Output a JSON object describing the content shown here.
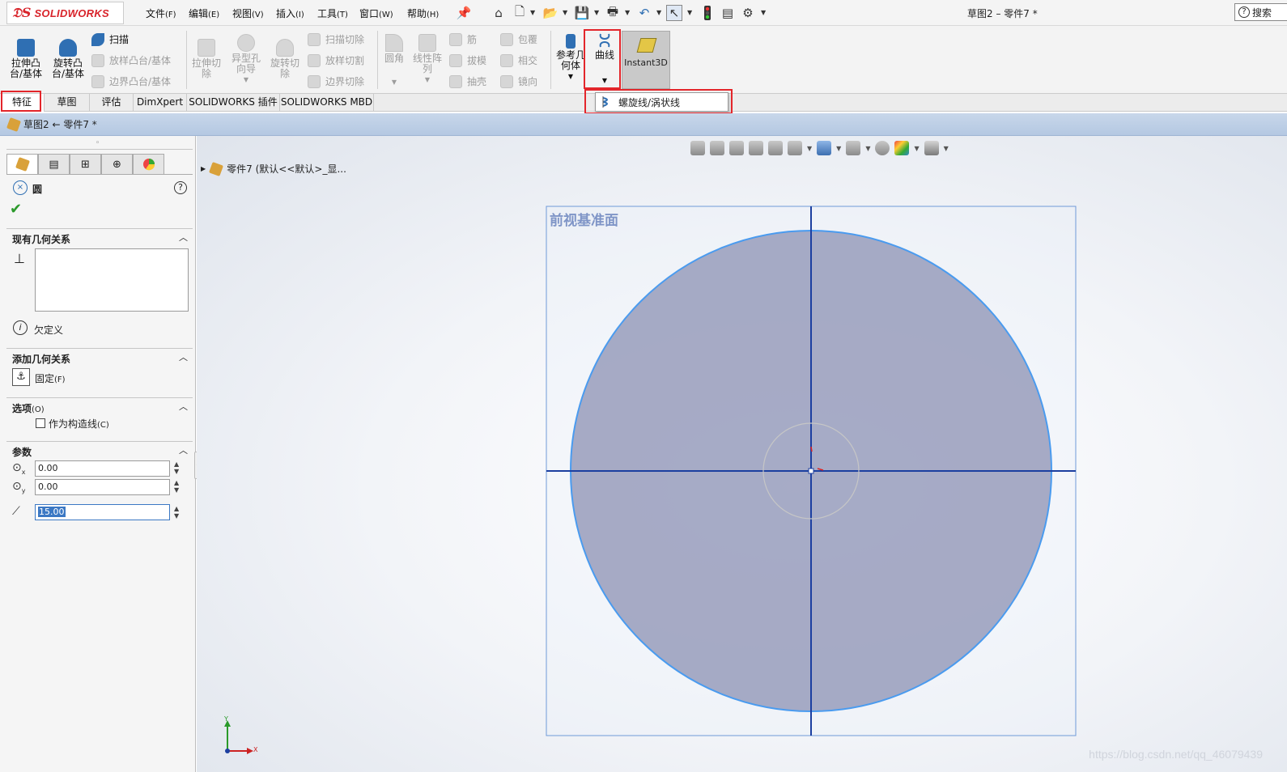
{
  "menubar": {
    "brand": "SOLIDWORKS",
    "menus": [
      {
        "label": "文件",
        "key": "(F)"
      },
      {
        "label": "编辑",
        "key": "(E)"
      },
      {
        "label": "视图",
        "key": "(V)"
      },
      {
        "label": "插入",
        "key": "(I)"
      },
      {
        "label": "工具",
        "key": "(T)"
      },
      {
        "label": "窗口",
        "key": "(W)"
      },
      {
        "label": "帮助",
        "key": "(H)"
      }
    ],
    "doc_title": "草图2 – 零件7 *",
    "search_label": "搜索"
  },
  "ribbon": {
    "extrude_boss": "拉伸凸台/基体",
    "revolve_boss": "旋转凸台/基体",
    "sweep": "扫描",
    "loft_boss": "放样凸台/基体",
    "boundary_boss": "边界凸台/基体",
    "extrude_cut": "拉伸切除",
    "hole_wizard": "异型孔向导",
    "revolve_cut": "旋转切除",
    "sweep_cut": "扫描切除",
    "loft_cut": "放样切割",
    "boundary_cut": "边界切除",
    "fillet": "圆角",
    "linear_pattern": "线性阵列",
    "rib": "筋",
    "draft": "拔模",
    "shell": "抽壳",
    "wrap": "包覆",
    "intersect": "相交",
    "mirror": "镜向",
    "ref_geometry": "参考几何体",
    "curves": "曲线",
    "instant3d": "Instant3D"
  },
  "tabs": [
    "特征",
    "草图",
    "评估",
    "DimXpert",
    "SOLIDWORKS 插件",
    "SOLIDWORKS MBD"
  ],
  "dropdown": {
    "item": "螺旋线/涡状线"
  },
  "breadcrumb": "草图2 ← 零件7 *",
  "panel": {
    "title": "圆",
    "existing_relations": "现有几何关系",
    "status": "欠定义",
    "add_relations": "添加几何关系",
    "fix": "固定",
    "fix_key": "(F)",
    "options": "选项",
    "options_key": "(O)",
    "construction": "作为构造线",
    "construction_key": "(C)",
    "params": "参数",
    "cx": "0.00",
    "cy": "0.00",
    "radius": "15.00"
  },
  "viewport": {
    "tree_root": "零件7  (默认<<默认>_显...",
    "plane_label": "前视基准面",
    "triad_x": "X",
    "triad_y": "Y",
    "watermark": "https://blog.csdn.net/qq_46079439"
  },
  "colors": {
    "accent_red": "#e3262b",
    "plane_fill": "#8f95b6",
    "sketch_blue": "#1c3fa0"
  }
}
